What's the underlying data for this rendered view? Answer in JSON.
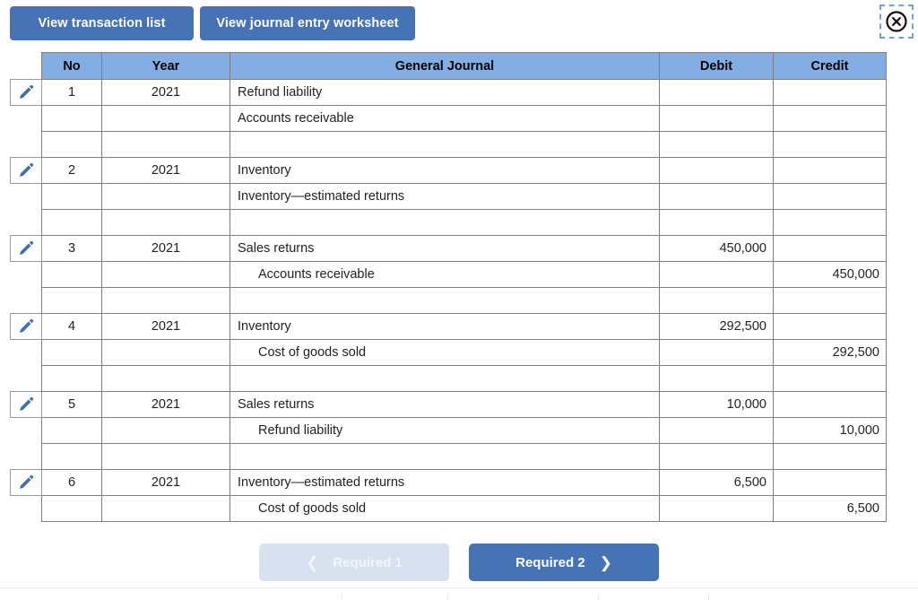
{
  "toolbar": {
    "transaction_list_label": "View transaction list",
    "journal_worksheet_label": "View journal entry worksheet",
    "close_icon": "close-circle-icon"
  },
  "table": {
    "columns": [
      "No",
      "Year",
      "General Journal",
      "Debit",
      "Credit"
    ],
    "edit_icon": "pencil-icon",
    "groups": [
      {
        "no": "1",
        "year": "2021",
        "lines": [
          {
            "account": "Refund liability",
            "indent": false,
            "debit": "",
            "credit": ""
          },
          {
            "account": "Accounts receivable",
            "indent": false,
            "debit": "",
            "credit": ""
          },
          {
            "account": "",
            "indent": false,
            "debit": "",
            "credit": ""
          }
        ]
      },
      {
        "no": "2",
        "year": "2021",
        "lines": [
          {
            "account": "Inventory",
            "indent": false,
            "debit": "",
            "credit": ""
          },
          {
            "account": "Inventory—estimated returns",
            "indent": false,
            "debit": "",
            "credit": ""
          },
          {
            "account": "",
            "indent": false,
            "debit": "",
            "credit": ""
          }
        ]
      },
      {
        "no": "3",
        "year": "2021",
        "lines": [
          {
            "account": "Sales returns",
            "indent": false,
            "debit": "450,000",
            "credit": ""
          },
          {
            "account": "Accounts receivable",
            "indent": true,
            "debit": "",
            "credit": "450,000"
          },
          {
            "account": "",
            "indent": false,
            "debit": "",
            "credit": ""
          }
        ]
      },
      {
        "no": "4",
        "year": "2021",
        "lines": [
          {
            "account": "Inventory",
            "indent": false,
            "debit": "292,500",
            "credit": ""
          },
          {
            "account": "Cost of goods sold",
            "indent": true,
            "debit": "",
            "credit": "292,500"
          },
          {
            "account": "",
            "indent": false,
            "debit": "",
            "credit": ""
          }
        ]
      },
      {
        "no": "5",
        "year": "2021",
        "lines": [
          {
            "account": "Sales returns",
            "indent": false,
            "debit": "10,000",
            "credit": ""
          },
          {
            "account": "Refund liability",
            "indent": true,
            "debit": "",
            "credit": "10,000"
          },
          {
            "account": "",
            "indent": false,
            "debit": "",
            "credit": ""
          }
        ]
      },
      {
        "no": "6",
        "year": "2021",
        "lines": [
          {
            "account": "Inventory—estimated returns",
            "indent": false,
            "debit": "6,500",
            "credit": ""
          },
          {
            "account": "Cost of goods sold",
            "indent": true,
            "debit": "",
            "credit": "6,500"
          }
        ]
      }
    ]
  },
  "footer": {
    "prev_label": "Required 1",
    "next_label": "Required 2",
    "prev_icon": "chevron-left-icon",
    "next_icon": "chevron-right-icon"
  },
  "colors": {
    "button_blue": "#4573b5",
    "header_blue": "#82aee3",
    "disabled_blue": "#d7e1ef",
    "grid_gray": "#7f7f7f",
    "pencil_blue": "#3c6fb4"
  }
}
